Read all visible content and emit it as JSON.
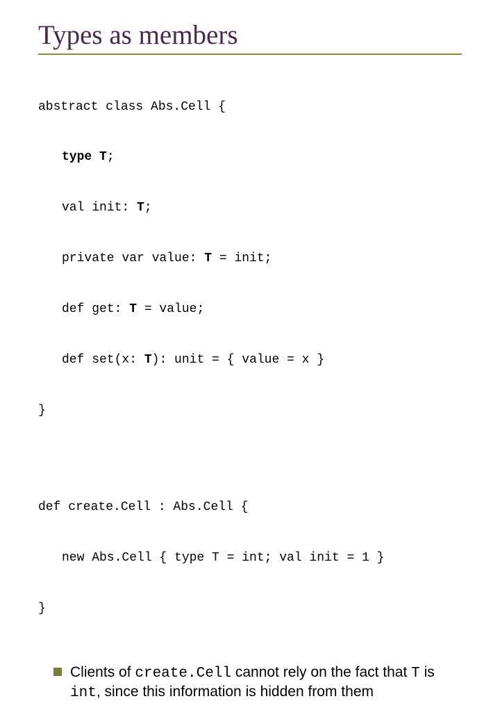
{
  "title": "Types as members",
  "code1": {
    "l1": "abstract class Abs.Cell {",
    "l2a": "type T",
    "l2b": ";",
    "l3a": "val init: ",
    "l3b": "T",
    "l3c": ";",
    "l4a": "private var value: ",
    "l4b": "T",
    "l4c": " = init;",
    "l5a": "def get: ",
    "l5b": "T",
    "l5c": " = value;",
    "l6a": "def set(x: ",
    "l6b": "T",
    "l6c": "): unit = { value = x }",
    "l7": "}"
  },
  "code2": {
    "l1": "def create.Cell : Abs.Cell {",
    "l2": "new Abs.Cell { type T = int; val init = 1 }",
    "l3": "}"
  },
  "bullet": {
    "p1": "Clients of ",
    "p2": "create.Cell",
    "p3": " cannot rely on the fact that ",
    "p4": "T",
    "p5": " is ",
    "p6": "int",
    "p7": ", since this information is hidden from them"
  }
}
